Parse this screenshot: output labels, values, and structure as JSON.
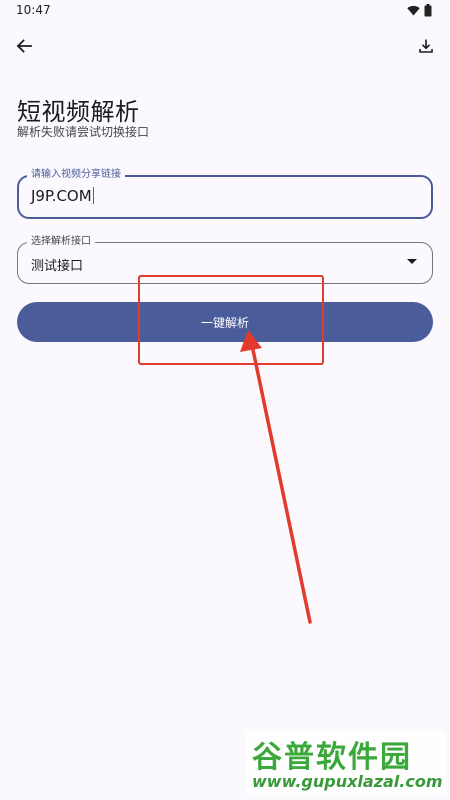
{
  "status_bar": {
    "time": "10:47",
    "icons": [
      "wifi-icon",
      "battery-icon"
    ]
  },
  "app_bar": {
    "back_icon": "arrow-left-icon",
    "download_icon": "download-icon"
  },
  "page": {
    "title": "短视频解析",
    "subtitle": "解析失败请尝试切换接口"
  },
  "url_input": {
    "label": "请输入视频分享链接",
    "value": "J9P.COM"
  },
  "interface_select": {
    "label": "选择解析接口",
    "value": "测试接口"
  },
  "parse_button": {
    "label": "一键解析"
  },
  "colors": {
    "primary": "#4a5c9a",
    "background": "#fbf8fe",
    "annotation": "#e23b2e",
    "watermark": "#3aa83a"
  },
  "watermark": {
    "title": "谷普软件园",
    "url": "www.gupuxlazal.com"
  }
}
